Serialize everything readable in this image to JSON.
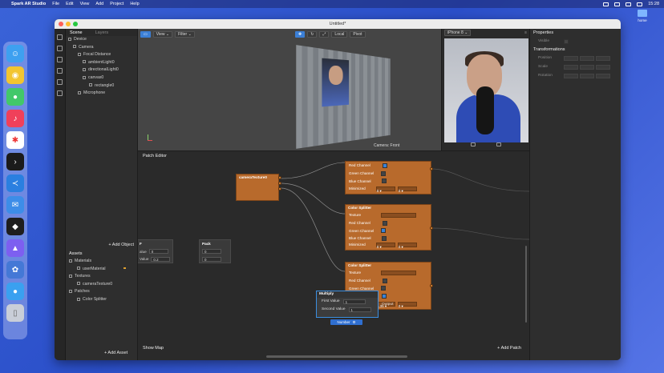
{
  "menubar": {
    "apple": "",
    "app": "Spark AR Studio",
    "items": [
      "File",
      "Edit",
      "View",
      "Add",
      "Project",
      "Help"
    ],
    "clock": "15:28"
  },
  "desktop": {
    "folder": "home"
  },
  "window": {
    "title": "Untitled*"
  },
  "scene": {
    "tabs": [
      "Scene",
      "Layers"
    ],
    "tree": [
      "Device",
      "Camera",
      "Focal Distance",
      "ambientLight0",
      "directionalLight0",
      "canvas0",
      "rectangle0",
      "Microphone"
    ],
    "add_object": "+ Add Object"
  },
  "assets": {
    "title": "Assets",
    "tree": [
      "Materials",
      "userMaterial",
      "Textures",
      "cameraTexture0",
      "Patches",
      "Color Splitter"
    ],
    "add_asset": "+ Add Asset"
  },
  "viewport": {
    "view": "View ⌄",
    "filter": "Filter ⌄",
    "local": "Local",
    "pivot": "Pivot",
    "camera_label": "Camera: Front"
  },
  "simulator": {
    "device": "iPhone 8 ⌄"
  },
  "properties": {
    "title": "Properties",
    "visible_label": "Visible",
    "transformations": "Transformations",
    "rows": [
      "Position",
      "Scale",
      "Rotation"
    ]
  },
  "patch_editor": {
    "title": "Patch Editor",
    "show_map": "Show Map",
    "add_patch": "+ Add Patch",
    "camera_texture": "cameraTexture0",
    "f_node": {
      "title": "F",
      "row1": "alue",
      "row2": "Value",
      "val1": "0",
      "val2": "0.2"
    },
    "pack": {
      "title": "Pack",
      "v1": "0",
      "v2": "0"
    },
    "splitter1": {
      "rows": [
        "Red Channel",
        "Green Channel",
        "Blue Channel",
        "Minimized"
      ],
      "dd1": "0 ▾",
      "dd2": "0 ▾"
    },
    "splitter2": {
      "title": "Color Splitter",
      "rows": [
        "Texture",
        "Red Channel",
        "Green Channel",
        "Blue Channel",
        "Minimized"
      ],
      "dd1": "0 ▾",
      "dd2": "0 ▾"
    },
    "splitter3": {
      "title": "Color Splitter",
      "rows": [
        "Texture",
        "Red Channel",
        "Green Channel",
        "Blue Channel",
        "Minimized"
      ],
      "dd1": "0.35 ▾",
      "dd2": "0 ▾"
    },
    "multiply": {
      "title": "Multiply",
      "first_label": "First Value",
      "first": "1",
      "second_label": "Second Value",
      "second": "1",
      "output": "Output"
    },
    "number_tag": "Number"
  }
}
